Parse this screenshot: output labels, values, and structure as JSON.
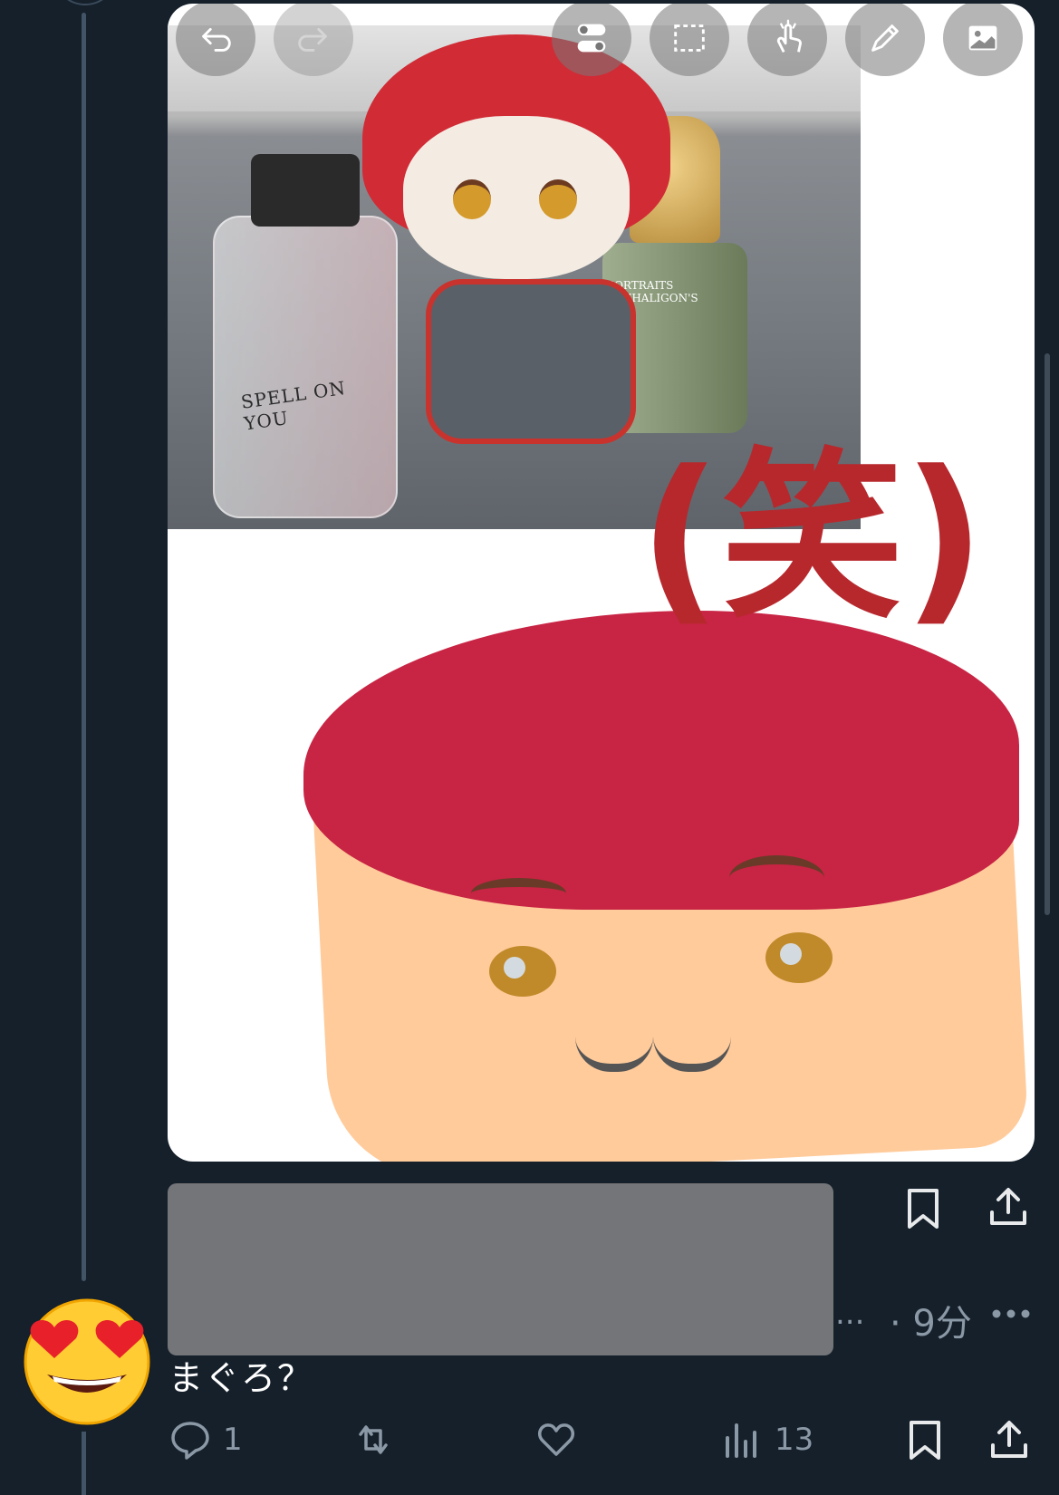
{
  "media": {
    "photo_label": "SPELL ON YOU",
    "right_bottle_label": "PORTRAITS PENHALIGON'S",
    "overlay_text": "(笑)"
  },
  "toolbar": {
    "icons": [
      "undo-icon",
      "redo-icon",
      "toggle-icon",
      "select-icon",
      "hand-tap-icon",
      "pencil-icon",
      "image-icon"
    ]
  },
  "reply": {
    "name_overflow": "...",
    "time": "· 9分",
    "text": "まぐろ？",
    "comments": "1",
    "retweets": "",
    "likes": "",
    "views": "13"
  },
  "colors": {
    "background": "#15202b",
    "muted": "#8b98a5",
    "overlay_red": "#b7282d"
  }
}
